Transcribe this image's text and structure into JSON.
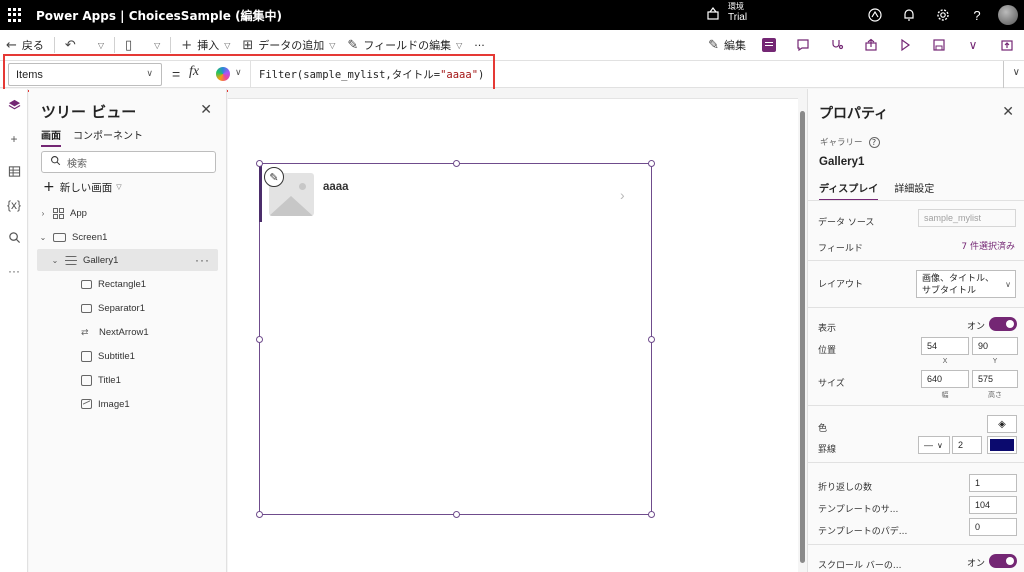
{
  "header": {
    "app_title": "Power Apps | ChoicesSample (編集中)",
    "env_label": "環境",
    "env_value": "Trial"
  },
  "commandbar": {
    "back": "戻る",
    "insert": "挿入",
    "add_data": "データの追加",
    "edit_fields": "フィールドの編集",
    "more": "···",
    "edit": "編集"
  },
  "formula": {
    "property": "Items",
    "equals": "=",
    "fx": "fx",
    "expr_prefix": "Filter(sample_mylist, ",
    "expr_field": "タイトル",
    "expr_op": "=",
    "expr_value": "\"aaaa\"",
    "expr_suffix": ")"
  },
  "tree": {
    "title": "ツリー ビュー",
    "tabs": [
      "画面",
      "コンポーネント"
    ],
    "search_placeholder": "検索",
    "new_screen": "新しい画面",
    "nodes": [
      {
        "label": "App"
      },
      {
        "label": "Screen1"
      },
      {
        "label": "Gallery1"
      },
      {
        "label": "Rectangle1"
      },
      {
        "label": "Separator1"
      },
      {
        "label": "NextArrow1"
      },
      {
        "label": "Subtitle1"
      },
      {
        "label": "Title1"
      },
      {
        "label": "Image1"
      }
    ]
  },
  "canvas": {
    "gallery_item_title": "aaaa"
  },
  "properties": {
    "title": "プロパティ",
    "control_type": "ギャラリー",
    "control_name": "Gallery1",
    "tabs": [
      "ディスプレイ",
      "詳細設定"
    ],
    "data_source_label": "データ ソース",
    "data_source_value": "sample_mylist",
    "fields_label": "フィールド",
    "fields_value": "7 件選択済み",
    "layout_label": "レイアウト",
    "layout_value": "画像、タイトル、サブタイトル",
    "visible_label": "表示",
    "visible_value": "オン",
    "position_label": "位置",
    "x_value": "54",
    "y_value": "90",
    "x_caption": "X",
    "y_caption": "Y",
    "size_label": "サイズ",
    "width_value": "640",
    "height_value": "575",
    "width_caption": "幅",
    "height_caption": "高さ",
    "color_label": "色",
    "border_label": "罫線",
    "border_style": "—",
    "border_width": "2",
    "border_color": "#0b0a6e",
    "wrap_label": "折り返しの数",
    "wrap_value": "1",
    "template_size_label": "テンプレートのサ...",
    "template_size_value": "104",
    "template_padding_label": "テンプレートのパデ...",
    "template_padding_value": "0",
    "scrollbar_label": "スクロール バーの...",
    "scrollbar_value": "オン"
  },
  "colors": {
    "accent": "#742774",
    "highlight_box": "#e53935"
  }
}
